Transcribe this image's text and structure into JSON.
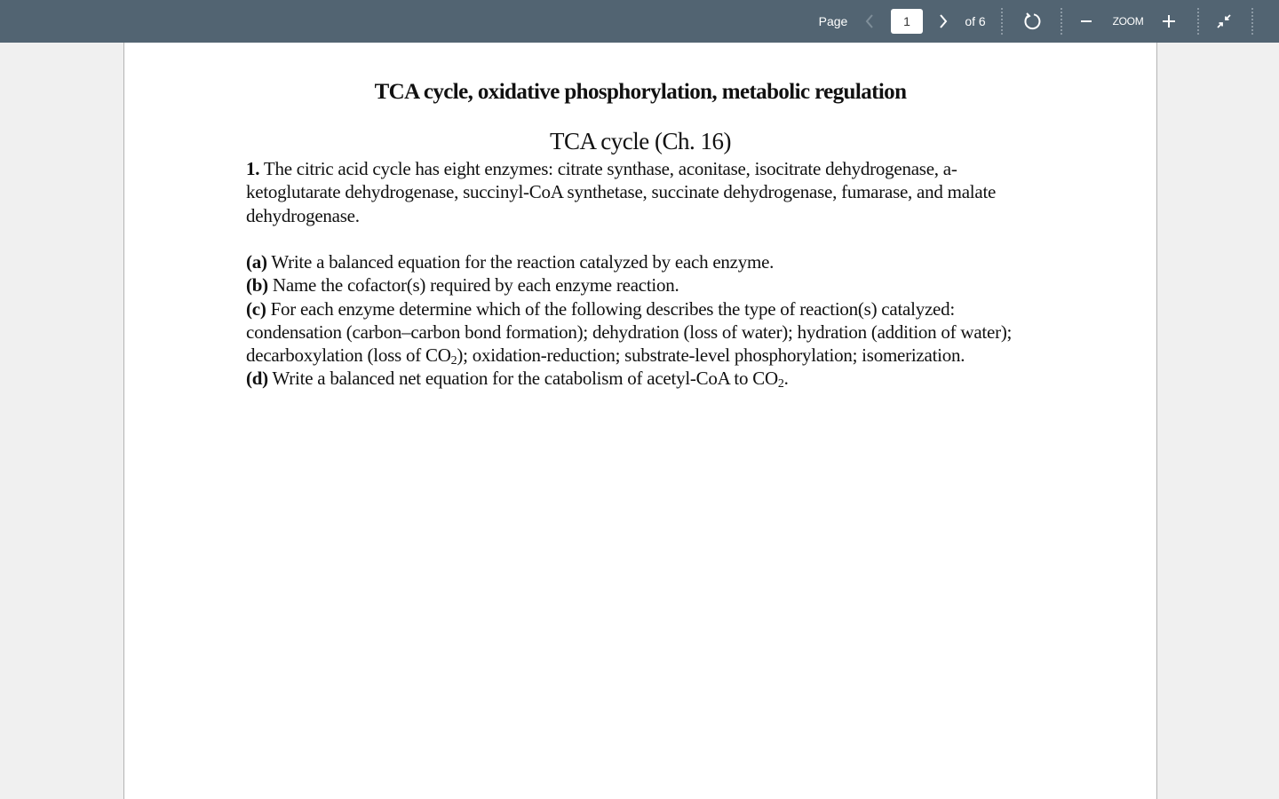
{
  "toolbar": {
    "page_label": "Page",
    "current_page": "1",
    "of_label": "of 6",
    "zoom_label": "ZOOM",
    "icons": {
      "prev": "chevron-left-icon",
      "next": "chevron-right-icon",
      "rotate": "rotate-icon",
      "zoom_out": "minus-icon",
      "zoom_in": "plus-icon",
      "fit": "collapse-icon"
    }
  },
  "document": {
    "title": "TCA cycle, oxidative phosphorylation, metabolic regulation",
    "section_title": "TCA cycle (Ch. 16)",
    "question1": {
      "number": "1.",
      "text": "The citric acid cycle has eight enzymes: citrate synthase, aconitase, isocitrate dehydrogenase, a-ketoglutarate dehydrogenase, succinyl-CoA synthetase, succinate dehydrogenase, fumarase, and malate dehydrogenase."
    },
    "parts": [
      {
        "label": "(a)",
        "text": "Write a balanced equation for the reaction catalyzed by each enzyme."
      },
      {
        "label": "(b)",
        "text": "Name the cofactor(s) required by each enzyme reaction."
      },
      {
        "label": "(c)",
        "text_before": "For each enzyme determine which of the following describes the type of reaction(s) catalyzed: condensation (carbon–carbon bond formation); dehydration (loss of water); hydration (addition of water); decarboxylation (loss of CO",
        "sub": "2",
        "text_after": "); oxidation-reduction; substrate-level phosphorylation; isomerization."
      },
      {
        "label": "(d)",
        "text_before": "Write a balanced net equation for the catabolism of acetyl-CoA to CO",
        "sub": "2",
        "text_after": "."
      }
    ]
  }
}
